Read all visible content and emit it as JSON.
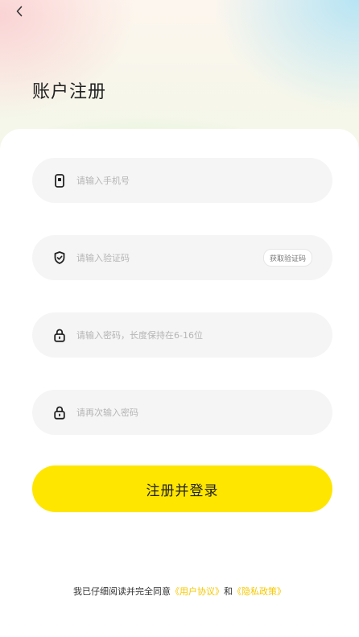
{
  "header": {
    "title": "账户注册"
  },
  "form": {
    "phone_placeholder": "请输入手机号",
    "code_placeholder": "请输入验证码",
    "get_code_label": "获取验证码",
    "password_placeholder": "请输入密码，长度保持在6-16位",
    "confirm_password_placeholder": "请再次输入密码",
    "submit_label": "注册并登录"
  },
  "agreement": {
    "prefix": "我已仔细阅读并完全同意",
    "user_agreement": "《用户协议》",
    "conjunction": "和",
    "privacy_policy": "《隐私政策》"
  },
  "icons": {
    "back": "chevron-left-icon",
    "phone": "phone-icon",
    "code": "shield-check-icon",
    "password": "lock-icon",
    "confirm_password": "lock-icon"
  },
  "colors": {
    "accent": "#fee600",
    "link": "#f5c800",
    "field_bg": "#f5f5f5"
  }
}
